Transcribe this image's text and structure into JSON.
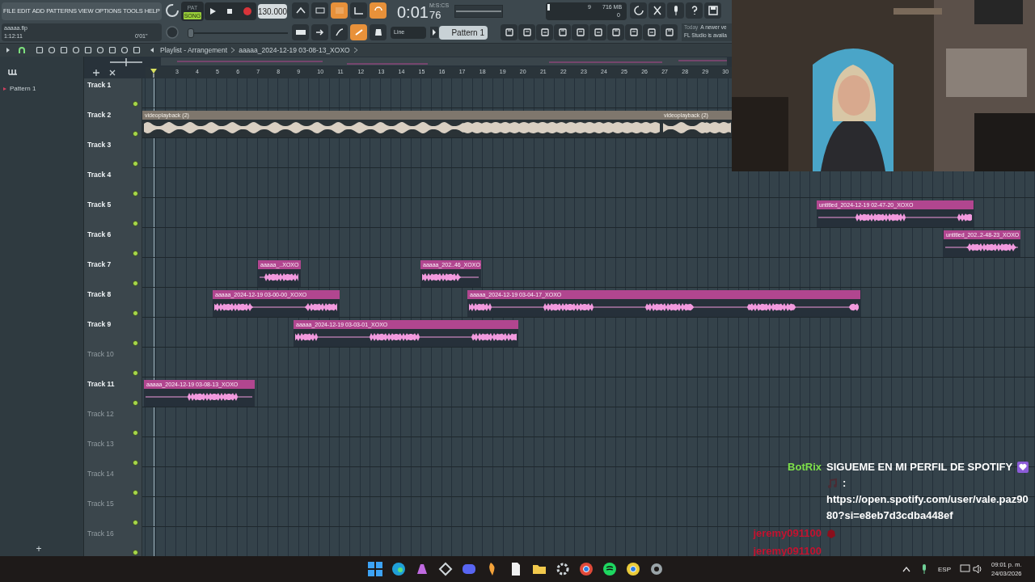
{
  "menu": [
    "FILE",
    "EDIT",
    "ADD",
    "PATTERNS",
    "VIEW",
    "OPTIONS",
    "TOOLS",
    "HELP"
  ],
  "project": {
    "file": "aaaaa.flp",
    "time": "1:12:11",
    "hint": "0'01''"
  },
  "mode_toggle": [
    {
      "label": "PAT",
      "selected": false
    },
    {
      "label": "SONG",
      "selected": true
    }
  ],
  "tempo": "130.000",
  "pitch_slider": {
    "level": 0
  },
  "clock": {
    "time": "0:01",
    "centiseconds": "76",
    "unit": "M:S:CS"
  },
  "monitor": {
    "voices": "9",
    "memory": "716 MB",
    "cpu": "0"
  },
  "snap": "Line",
  "pattern": "Pattern 1",
  "news": {
    "date": "Today",
    "line_1": "A newer ve",
    "line_2": "FL Studio is availa"
  },
  "playlist": {
    "title": "Playlist - Arrangement",
    "breadcrumb": "aaaaa_2024-12-19 03-08-13_XOXO"
  },
  "browser": {
    "items": [
      {
        "label": "Pattern 1"
      }
    ],
    "add_label": "+"
  },
  "ruler": [
    "3",
    "4",
    "5",
    "6",
    "7",
    "8",
    "9",
    "10",
    "11",
    "12",
    "13",
    "14",
    "15",
    "16",
    "17",
    "18",
    "19",
    "20",
    "21",
    "22",
    "23",
    "24",
    "25",
    "26",
    "27",
    "28",
    "29",
    "30"
  ],
  "tracks": [
    {
      "name": "Track 1",
      "dimmed": false
    },
    {
      "name": "Track 2",
      "dimmed": false,
      "clips": [
        {
          "label": "videoplayback (2)",
          "kind": "video"
        },
        {
          "label": "videoplayback (2)",
          "kind": "video"
        }
      ]
    },
    {
      "name": "Track 3",
      "dimmed": false
    },
    {
      "name": "Track 4",
      "dimmed": false
    },
    {
      "name": "Track 5",
      "dimmed": false,
      "clips": [
        {
          "label": "untitled_2024-12-19 02-47-20_XOXO",
          "kind": "audio"
        }
      ]
    },
    {
      "name": "Track 6",
      "dimmed": false,
      "clips": [
        {
          "label": "untitled_202..2-48-23_XOXO",
          "kind": "audio"
        }
      ]
    },
    {
      "name": "Track 7",
      "dimmed": false,
      "clips": [
        {
          "label": "aaaaa_..XOXO",
          "kind": "audio"
        },
        {
          "label": "aaaaa_202..46_XOXO",
          "kind": "audio"
        }
      ]
    },
    {
      "name": "Track 8",
      "dimmed": false,
      "clips": [
        {
          "label": "aaaaa_2024-12-19 03-00-00_XOXO",
          "kind": "audio"
        },
        {
          "label": "aaaaa_2024-12-19 03-04-17_XOXO",
          "kind": "audio"
        }
      ]
    },
    {
      "name": "Track 9",
      "dimmed": false,
      "clips": [
        {
          "label": "aaaaa_2024-12-19 03-03-01_XOXO",
          "kind": "audio"
        }
      ]
    },
    {
      "name": "Track 10",
      "dimmed": true
    },
    {
      "name": "Track 11",
      "dimmed": false,
      "clips": [
        {
          "label": "aaaaa_2024-12-19 03-08-13_XOXO",
          "kind": "audio"
        }
      ]
    },
    {
      "name": "Track 12",
      "dimmed": true
    },
    {
      "name": "Track 13",
      "dimmed": true
    },
    {
      "name": "Track 14",
      "dimmed": true
    },
    {
      "name": "Track 15",
      "dimmed": true
    },
    {
      "name": "Track 16",
      "dimmed": true
    }
  ],
  "chat": [
    {
      "user": "BotRix",
      "color": "#7ee04a",
      "parts": [
        {
          "kind": "text",
          "text": "SIGUEME EN MI PERFIL DE SPOTIFY"
        },
        {
          "kind": "heart"
        },
        {
          "kind": "note"
        },
        {
          "kind": "text",
          "text": ":"
        },
        {
          "kind": "text",
          "text": "https://open.spotify.com/user/vale.paz9080?si=e8eb7d3cdba448ef"
        }
      ]
    },
    {
      "user": "jeremy091100",
      "color": "#c4122f",
      "parts": [
        {
          "kind": "gem"
        }
      ]
    },
    {
      "user": "jeremy091100",
      "color": "#c4122f"
    }
  ],
  "tray": {
    "language": "ESP",
    "time": "09:01 p. m.",
    "date": "24/03/2026"
  }
}
